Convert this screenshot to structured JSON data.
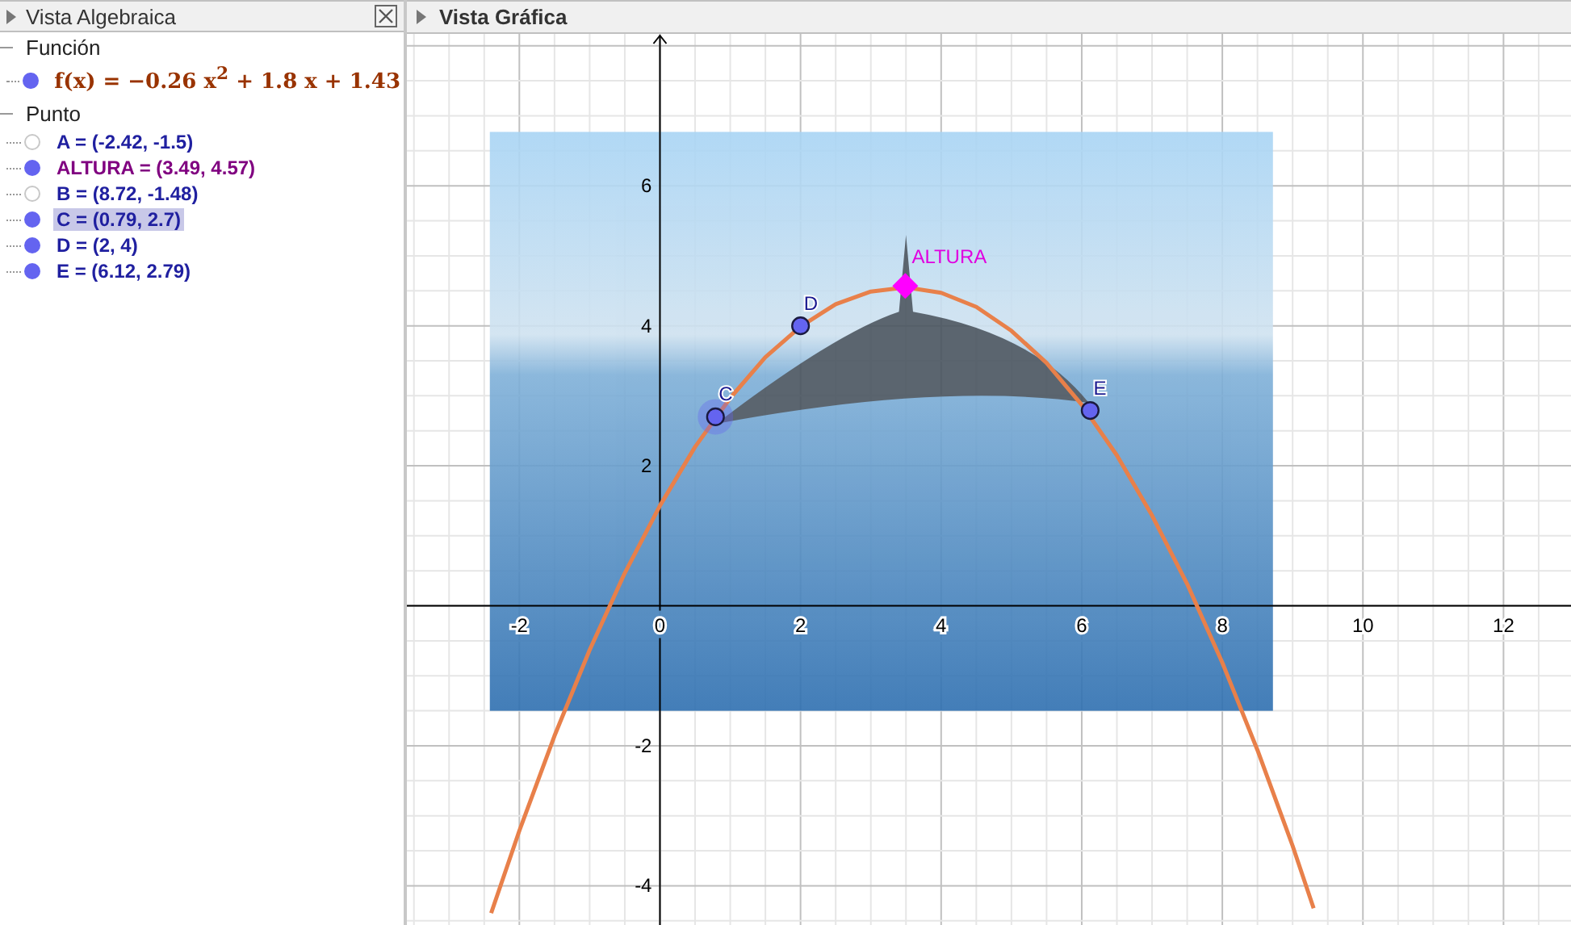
{
  "algebra_view": {
    "title": "Vista Algebraica",
    "groups": [
      {
        "label": "Función",
        "expanded": true,
        "children": [
          {
            "text": "f(x) = −0.26 x$^{2}$ + 1.8 x + 1.43",
            "kind": "function",
            "visible": true,
            "selected": false,
            "color": "#993300"
          }
        ]
      },
      {
        "label": "Punto",
        "expanded": true,
        "children": [
          {
            "text": "A = (-2.42, -1.5)",
            "kind": "point",
            "visible": false,
            "selected": false,
            "color": "#2020a0"
          },
          {
            "text": "ALTURA = (3.49, 4.57)",
            "kind": "point",
            "visible": true,
            "selected": false,
            "color": "#800080"
          },
          {
            "text": "B = (8.72, -1.48)",
            "kind": "point",
            "visible": false,
            "selected": false,
            "color": "#2020a0"
          },
          {
            "text": "C = (0.79, 2.7)",
            "kind": "point",
            "visible": true,
            "selected": true,
            "color": "#2020a0"
          },
          {
            "text": "D = (2, 4)",
            "kind": "point",
            "visible": true,
            "selected": false,
            "color": "#2020a0"
          },
          {
            "text": "E = (6.12, 2.79)",
            "kind": "point",
            "visible": true,
            "selected": false,
            "color": "#2020a0"
          }
        ]
      }
    ]
  },
  "graphics_view": {
    "title": "Vista Gráfica",
    "chart_data": {
      "type": "line",
      "grid": true,
      "xlim": [
        -3.6,
        12.96
      ],
      "ylim": [
        -4.56,
        8.17
      ],
      "xticks": [
        {
          "value": -2,
          "label": "-2"
        },
        {
          "value": 0,
          "label": "0"
        },
        {
          "value": 2,
          "label": "2"
        },
        {
          "value": 4,
          "label": "4"
        },
        {
          "value": 6,
          "label": "6"
        },
        {
          "value": 8,
          "label": "8"
        },
        {
          "value": 10,
          "label": "10"
        },
        {
          "value": 12,
          "label": "12"
        }
      ],
      "yticks": [
        {
          "value": -4,
          "label": "-4"
        },
        {
          "value": -2,
          "label": "-2"
        },
        {
          "value": 2,
          "label": "2"
        },
        {
          "value": 4,
          "label": "4"
        },
        {
          "value": 6,
          "label": "6"
        }
      ],
      "series": [
        {
          "color": "#e8804a",
          "x": [
            -2.4,
            -2,
            -1.5,
            -1,
            -0.5,
            0,
            0.5,
            1,
            1.5,
            2,
            2.5,
            3,
            3.5,
            4,
            4.5,
            5,
            5.5,
            6,
            6.5,
            7,
            7.5,
            8,
            8.5,
            9,
            9.3
          ],
          "values": [
            -4.39,
            -3.21,
            -1.86,
            -0.63,
            0.47,
            1.43,
            2.27,
            2.97,
            3.55,
            3.99,
            4.31,
            4.49,
            4.55,
            4.47,
            4.27,
            3.93,
            3.47,
            2.87,
            2.15,
            1.29,
            0.31,
            -0.81,
            -2.06,
            -3.43,
            -4.32
          ]
        }
      ],
      "annotations": [
        {
          "text": "C",
          "x": 0.79,
          "y": 2.7
        },
        {
          "text": "D",
          "x": 2,
          "y": 4
        },
        {
          "text": "ALTURA",
          "x": 3.49,
          "y": 4.57
        },
        {
          "text": "E",
          "x": 6.12,
          "y": 2.79
        }
      ]
    },
    "points": [
      {
        "kind": "circle",
        "selected": true
      },
      {
        "kind": "circle",
        "selected": false
      },
      {
        "kind": "diamond",
        "selected": false
      },
      {
        "kind": "circle",
        "selected": false
      }
    ]
  }
}
